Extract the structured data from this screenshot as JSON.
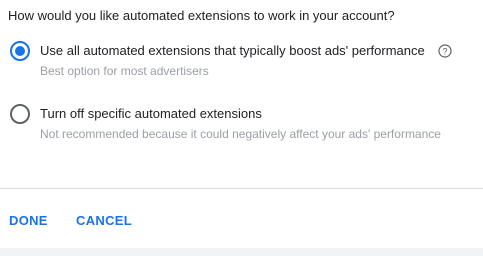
{
  "question": "How would you like automated extensions to work in your account?",
  "options": [
    {
      "label": "Use all automated extensions that typically boost ads' performance",
      "description": "Best option for most advertisers",
      "selected": true,
      "help_icon": "help-circle-icon"
    },
    {
      "label": "Turn off specific automated extensions",
      "description": "Not recommended because it could negatively affect your ads' performance",
      "selected": false
    }
  ],
  "actions": {
    "done_label": "DONE",
    "cancel_label": "CANCEL"
  },
  "colors": {
    "accent": "#1a73e8",
    "text_primary": "#202124",
    "text_secondary": "#9aa0a6",
    "divider": "#dadce0"
  }
}
